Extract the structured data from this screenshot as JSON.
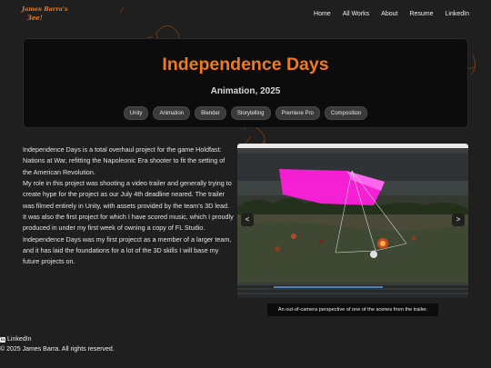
{
  "colors": {
    "accent": "#f07a1d",
    "background": "#1f1f1f",
    "card": "#0c0c0c",
    "tag_bg": "#3a3a3a",
    "editor_magenta": "#ff1fdc"
  },
  "logo": {
    "line1": "James Barra's",
    "line2": "3ee!"
  },
  "nav": {
    "items": [
      "Home",
      "All Works",
      "About",
      "Resume",
      "LinkedIn"
    ]
  },
  "hero": {
    "title": "Independence Days",
    "subtitle": "Animation, 2025",
    "tags": [
      "Unity",
      "Animation",
      "Blender",
      "Storytelling",
      "Premiere Pro",
      "Composition"
    ]
  },
  "description": {
    "paragraphs": [
      "Independence Days is a total overhaul project for the game Holdfast: Nations at War, refitting the Napoleonic Era shooter to fit the setting of the American Revolution.",
      "My role in this project was shooting a video trailer and generally trying to create hype for the project as our July 4th deadline neared. The trailer was filmed entirely in Unity, with assets provided by the team's 3D lead. It was also the first project for which I have scored music, which I proudly produced in under my first week of owning a copy of FL Studio.",
      "Independence Days was my first projecct as a member of a larger team, and it has laid the foundations for a lot of the 3D skills I will base my future projects on."
    ]
  },
  "media": {
    "prev_label": "<",
    "next_label": ">",
    "caption": "An out-of-camera perspective of one of the scenes from the trailer."
  },
  "footer": {
    "linkedin_label": "LinkedIn",
    "copyright": "© 2025 James Barra. All rights reserved."
  },
  "icons": [
    "linkedin-icon",
    "chevron-left-icon",
    "chevron-right-icon"
  ]
}
